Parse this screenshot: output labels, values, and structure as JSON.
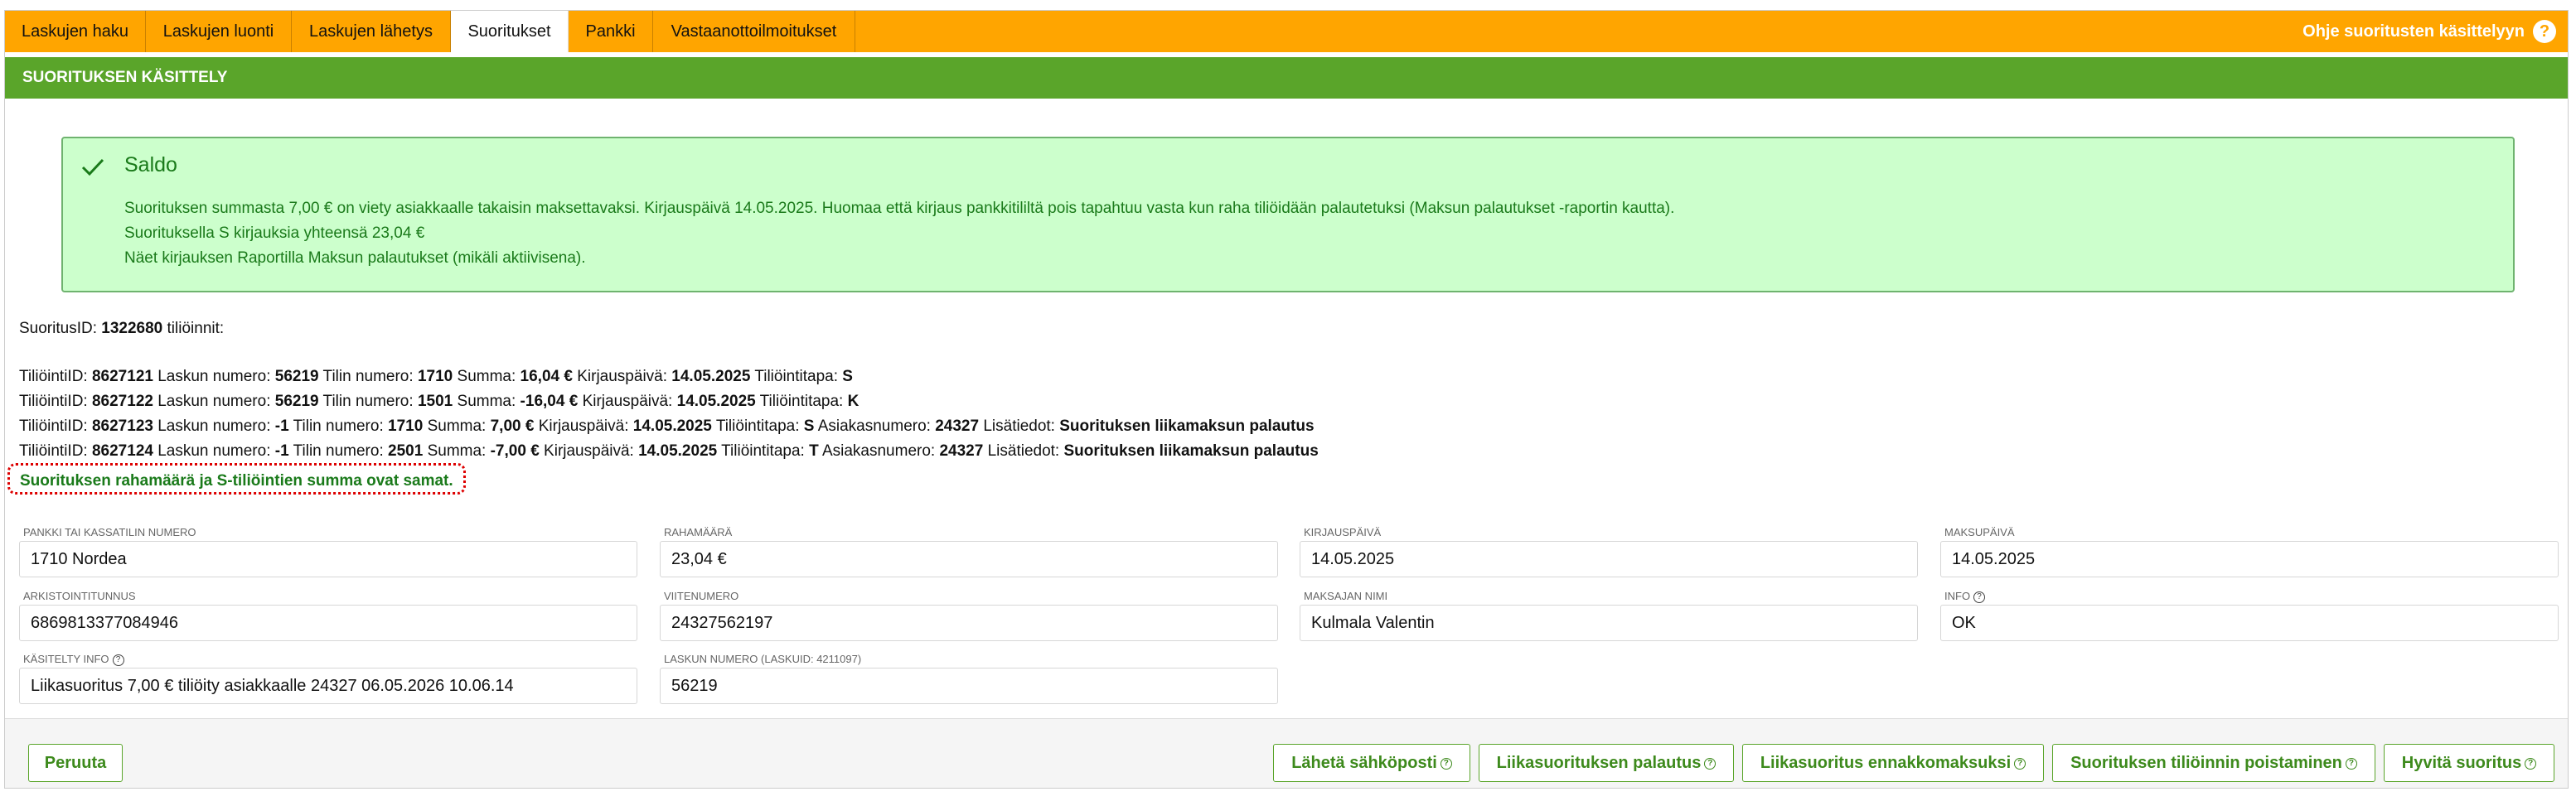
{
  "tabs": [
    {
      "label": "Laskujen haku"
    },
    {
      "label": "Laskujen luonti"
    },
    {
      "label": "Laskujen lähetys"
    },
    {
      "label": "Suoritukset",
      "active": true
    },
    {
      "label": "Pankki"
    },
    {
      "label": "Vastaanottoilmoitukset"
    }
  ],
  "help_link": "Ohje suoritusten käsittelyyn",
  "help_icon": "?",
  "section_title": "SUORITUKSEN KÄSITTELY",
  "alert": {
    "title": "Saldo",
    "lines": [
      "Suorituksen summasta 7,00 € on viety asiakkaalle takaisin maksettavaksi. Kirjauspäivä 14.05.2025. Huomaa että kirjaus pankkitililtä pois tapahtuu vasta kun raha tiliöidään palautetuksi (Maksun palautukset -raportin kautta).",
      "Suorituksella S kirjauksia yhteensä 23,04 €",
      "Näet kirjauksen Raportilla Maksun palautukset (mikäli aktiivisena)."
    ]
  },
  "suoritus": {
    "prefix": "SuoritusID:",
    "id": "1322680",
    "suffix": "tiliöinnit:"
  },
  "rows": [
    {
      "id": "8627121",
      "lasku": "56219",
      "tili": "1710",
      "summa": "16,04 €",
      "pvm": "14.05.2025",
      "tapa": "S",
      "asiakas": "",
      "lisa": ""
    },
    {
      "id": "8627122",
      "lasku": "56219",
      "tili": "1501",
      "summa": "-16,04 €",
      "pvm": "14.05.2025",
      "tapa": "K",
      "asiakas": "",
      "lisa": ""
    },
    {
      "id": "8627123",
      "lasku": "-1",
      "tili": "1710",
      "summa": "7,00 €",
      "pvm": "14.05.2025",
      "tapa": "S",
      "asiakas": "24327",
      "lisa": "Suorituksen liikamaksun palautus"
    },
    {
      "id": "8627124",
      "lasku": "-1",
      "tili": "2501",
      "summa": "-7,00 €",
      "pvm": "14.05.2025",
      "tapa": "T",
      "asiakas": "24327",
      "lisa": "Suorituksen liikamaksun palautus"
    }
  ],
  "row_labels": {
    "id": "TiliöintiID:",
    "lasku": "Laskun numero:",
    "tili": "Tilin numero:",
    "summa": "Summa:",
    "pvm": "Kirjauspäivä:",
    "tapa": "Tiliöintitapa:",
    "asiakas": "Asiakasnumero:",
    "lisa": "Lisätiedot:"
  },
  "match_message": "Suorituksen rahamäärä ja S-tiliöintien summa ovat samat.",
  "fields": {
    "pankki": {
      "label": "Pankki tai kassatilin numero",
      "value": "1710 Nordea"
    },
    "rahamaara": {
      "label": "Rahamäärä",
      "value": "23,04 €"
    },
    "kirjauspaiva": {
      "label": "Kirjauspäivä",
      "value": "14.05.2025"
    },
    "maksupaiva": {
      "label": "Maksupäivä",
      "value": "14.05.2025"
    },
    "arkistointitunnus": {
      "label": "Arkistointitunnus",
      "value": "6869813377084946"
    },
    "viitenumero": {
      "label": "Viitenumero",
      "value": "24327562197"
    },
    "maksajan_nimi": {
      "label": "Maksajan nimi",
      "value": "Kulmala Valentin"
    },
    "info": {
      "label": "Info",
      "value": "OK"
    },
    "kasitelty_info": {
      "label": "Käsitelty info",
      "value": "Liikasuoritus 7,00 € tiliöity asiakkaalle 24327 06.05.2026 10.06.14"
    },
    "laskun_numero": {
      "label": "Laskun numero (laskuid: 4211097)",
      "value": "56219"
    }
  },
  "buttons": {
    "cancel": "Peruuta",
    "email": "Lähetä sähköposti",
    "refund": "Liikasuorituksen palautus",
    "prepay": "Liikasuoritus ennakkomaksuksi",
    "remove": "Suorituksen tiliöinnin poistaminen",
    "credit": "Hyvitä suoritus"
  },
  "colors": {
    "tabbar": "#ffa500",
    "header": "#5aa52a",
    "alert_bg": "#ccffcc",
    "alert_text": "#1a7a1a"
  }
}
